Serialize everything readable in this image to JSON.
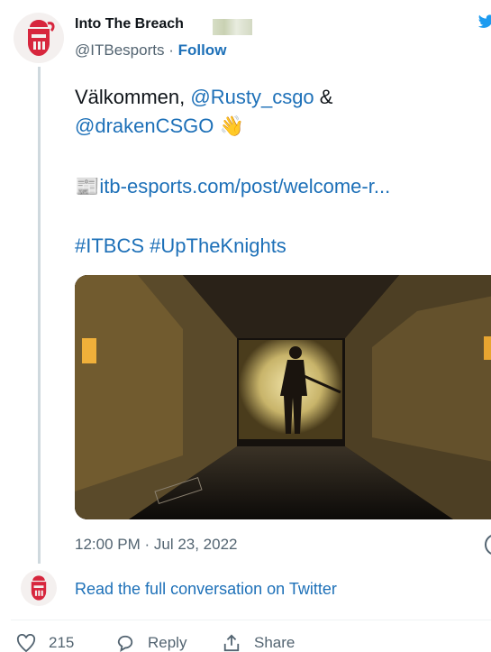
{
  "tweet": {
    "author_name": "Into The Breach",
    "handle": "@ITBesports",
    "separator": "·",
    "follow_label": "Follow",
    "text_line1_prefix": "Välkommen, ",
    "mention1": "@Rusty_csgo",
    "text_line1_suffix": " &",
    "mention2": "@drakenCSGO",
    "wave_emoji": "👋",
    "newspaper_emoji": "📰",
    "link_text": "itb-esports.com/post/welcome-r...",
    "hashtag1": "#ITBCS",
    "hashtag2": "#UpTheKnights",
    "timestamp": "12:00 PM · Jul 23, 2022"
  },
  "footer": {
    "read_full_label": "Read the full conversation on Twitter",
    "like_count": "215",
    "reply_label": "Reply",
    "share_label": "Share"
  },
  "colors": {
    "link": "#1d70b8",
    "secondary_text": "#536471",
    "brand_red": "#d7263d"
  },
  "icons": [
    "itb-knight-logo",
    "twitter-bird-icon",
    "info-icon",
    "heart-icon",
    "reply-icon",
    "share-icon"
  ]
}
